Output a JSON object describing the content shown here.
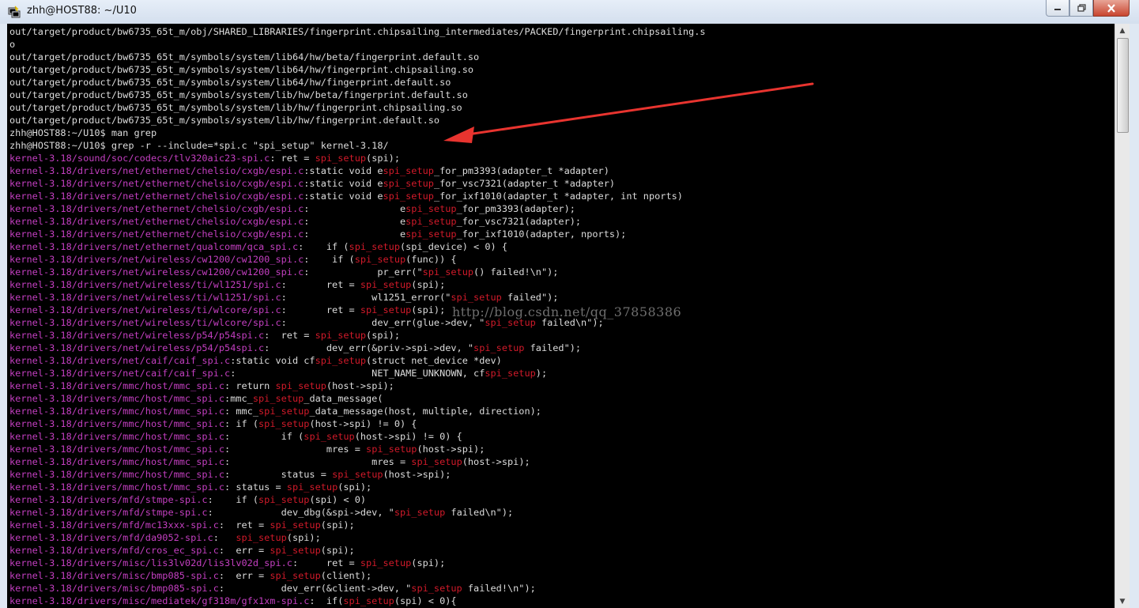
{
  "window": {
    "title": "zhh@HOST88: ~/U10",
    "minimize_icon": "minimize-icon",
    "maximize_icon": "maximize-icon",
    "close_icon": "close-icon"
  },
  "watermark": "http://blog.csdn.net/qq_37858386",
  "colors": {
    "terminal_bg": "#000000",
    "text": "#dcdcdc",
    "filename": "#c43fc1",
    "match": "#d21a2a",
    "annotation_arrow": "#e8342f"
  },
  "terminal": {
    "lines": [
      [
        {
          "t": "out/target/product/bw6735_65t_m/obj/SHARED_LIBRARIES/fingerprint.chipsailing_intermediates/PACKED/fingerprint.chipsailing.s"
        }
      ],
      [
        {
          "t": "o"
        }
      ],
      [
        {
          "t": "out/target/product/bw6735_65t_m/symbols/system/lib64/hw/beta/fingerprint.default.so"
        }
      ],
      [
        {
          "t": "out/target/product/bw6735_65t_m/symbols/system/lib64/hw/fingerprint.chipsailing.so"
        }
      ],
      [
        {
          "t": "out/target/product/bw6735_65t_m/symbols/system/lib64/hw/fingerprint.default.so"
        }
      ],
      [
        {
          "t": "out/target/product/bw6735_65t_m/symbols/system/lib/hw/beta/fingerprint.default.so"
        }
      ],
      [
        {
          "t": "out/target/product/bw6735_65t_m/symbols/system/lib/hw/fingerprint.chipsailing.so"
        }
      ],
      [
        {
          "t": "out/target/product/bw6735_65t_m/symbols/system/lib/hw/fingerprint.default.so"
        }
      ],
      [
        {
          "t": "zhh@HOST88:~/U10$ man grep"
        }
      ],
      [
        {
          "t": "zhh@HOST88:~/U10$ grep -r --include=*spi.c \"spi_setup\" kernel-3.18/"
        }
      ],
      [
        {
          "t": "kernel-3.18/sound/soc/codecs/tlv320aic23-spi.c",
          "c": "fn"
        },
        {
          "t": ": ret = "
        },
        {
          "t": "spi_setup",
          "c": "mt"
        },
        {
          "t": "(spi);"
        }
      ],
      [
        {
          "t": "kernel-3.18/drivers/net/ethernet/chelsio/cxgb/espi.c",
          "c": "fn"
        },
        {
          "t": ":static void e"
        },
        {
          "t": "spi_setup",
          "c": "mt"
        },
        {
          "t": "_for_pm3393(adapter_t *adapter)"
        }
      ],
      [
        {
          "t": "kernel-3.18/drivers/net/ethernet/chelsio/cxgb/espi.c",
          "c": "fn"
        },
        {
          "t": ":static void e"
        },
        {
          "t": "spi_setup",
          "c": "mt"
        },
        {
          "t": "_for_vsc7321(adapter_t *adapter)"
        }
      ],
      [
        {
          "t": "kernel-3.18/drivers/net/ethernet/chelsio/cxgb/espi.c",
          "c": "fn"
        },
        {
          "t": ":static void e"
        },
        {
          "t": "spi_setup",
          "c": "mt"
        },
        {
          "t": "_for_ixf1010(adapter_t *adapter, int nports)"
        }
      ],
      [
        {
          "t": "kernel-3.18/drivers/net/ethernet/chelsio/cxgb/espi.c",
          "c": "fn"
        },
        {
          "t": ":                e"
        },
        {
          "t": "spi_setup",
          "c": "mt"
        },
        {
          "t": "_for_pm3393(adapter);"
        }
      ],
      [
        {
          "t": "kernel-3.18/drivers/net/ethernet/chelsio/cxgb/espi.c",
          "c": "fn"
        },
        {
          "t": ":                e"
        },
        {
          "t": "spi_setup",
          "c": "mt"
        },
        {
          "t": "_for_vsc7321(adapter);"
        }
      ],
      [
        {
          "t": "kernel-3.18/drivers/net/ethernet/chelsio/cxgb/espi.c",
          "c": "fn"
        },
        {
          "t": ":                e"
        },
        {
          "t": "spi_setup",
          "c": "mt"
        },
        {
          "t": "_for_ixf1010(adapter, nports);"
        }
      ],
      [
        {
          "t": "kernel-3.18/drivers/net/ethernet/qualcomm/qca_spi.c",
          "c": "fn"
        },
        {
          "t": ":    if ("
        },
        {
          "t": "spi_setup",
          "c": "mt"
        },
        {
          "t": "(spi_device) < 0) {"
        }
      ],
      [
        {
          "t": "kernel-3.18/drivers/net/wireless/cw1200/cw1200_spi.c",
          "c": "fn"
        },
        {
          "t": ":    if ("
        },
        {
          "t": "spi_setup",
          "c": "mt"
        },
        {
          "t": "(func)) {"
        }
      ],
      [
        {
          "t": "kernel-3.18/drivers/net/wireless/cw1200/cw1200_spi.c",
          "c": "fn"
        },
        {
          "t": ":            pr_err(\""
        },
        {
          "t": "spi_setup",
          "c": "mt"
        },
        {
          "t": "() failed!\\n\");"
        }
      ],
      [
        {
          "t": "kernel-3.18/drivers/net/wireless/ti/wl1251/spi.c",
          "c": "fn"
        },
        {
          "t": ":       ret = "
        },
        {
          "t": "spi_setup",
          "c": "mt"
        },
        {
          "t": "(spi);"
        }
      ],
      [
        {
          "t": "kernel-3.18/drivers/net/wireless/ti/wl1251/spi.c",
          "c": "fn"
        },
        {
          "t": ":               wl1251_error(\""
        },
        {
          "t": "spi_setup",
          "c": "mt"
        },
        {
          "t": " failed\");"
        }
      ],
      [
        {
          "t": "kernel-3.18/drivers/net/wireless/ti/wlcore/spi.c",
          "c": "fn"
        },
        {
          "t": ":       ret = "
        },
        {
          "t": "spi_setup",
          "c": "mt"
        },
        {
          "t": "(spi);"
        }
      ],
      [
        {
          "t": "kernel-3.18/drivers/net/wireless/ti/wlcore/spi.c",
          "c": "fn"
        },
        {
          "t": ":               dev_err(glue->dev, \""
        },
        {
          "t": "spi_setup",
          "c": "mt"
        },
        {
          "t": " failed\\n\");"
        }
      ],
      [
        {
          "t": "kernel-3.18/drivers/net/wireless/p54/p54spi.c",
          "c": "fn"
        },
        {
          "t": ":  ret = "
        },
        {
          "t": "spi_setup",
          "c": "mt"
        },
        {
          "t": "(spi);"
        }
      ],
      [
        {
          "t": "kernel-3.18/drivers/net/wireless/p54/p54spi.c",
          "c": "fn"
        },
        {
          "t": ":          dev_err(&priv->spi->dev, \""
        },
        {
          "t": "spi_setup",
          "c": "mt"
        },
        {
          "t": " failed\");"
        }
      ],
      [
        {
          "t": "kernel-3.18/drivers/net/caif/caif_spi.c",
          "c": "fn"
        },
        {
          "t": ":static void cf"
        },
        {
          "t": "spi_setup",
          "c": "mt"
        },
        {
          "t": "(struct net_device *dev)"
        }
      ],
      [
        {
          "t": "kernel-3.18/drivers/net/caif/caif_spi.c",
          "c": "fn"
        },
        {
          "t": ":                        NET_NAME_UNKNOWN, cf"
        },
        {
          "t": "spi_setup",
          "c": "mt"
        },
        {
          "t": ");"
        }
      ],
      [
        {
          "t": "kernel-3.18/drivers/mmc/host/mmc_spi.c",
          "c": "fn"
        },
        {
          "t": ": return "
        },
        {
          "t": "spi_setup",
          "c": "mt"
        },
        {
          "t": "(host->spi);"
        }
      ],
      [
        {
          "t": "kernel-3.18/drivers/mmc/host/mmc_spi.c",
          "c": "fn"
        },
        {
          "t": ":mmc_"
        },
        {
          "t": "spi_setup",
          "c": "mt"
        },
        {
          "t": "_data_message("
        }
      ],
      [
        {
          "t": "kernel-3.18/drivers/mmc/host/mmc_spi.c",
          "c": "fn"
        },
        {
          "t": ": mmc_"
        },
        {
          "t": "spi_setup",
          "c": "mt"
        },
        {
          "t": "_data_message(host, multiple, direction);"
        }
      ],
      [
        {
          "t": "kernel-3.18/drivers/mmc/host/mmc_spi.c",
          "c": "fn"
        },
        {
          "t": ": if ("
        },
        {
          "t": "spi_setup",
          "c": "mt"
        },
        {
          "t": "(host->spi) != 0) {"
        }
      ],
      [
        {
          "t": "kernel-3.18/drivers/mmc/host/mmc_spi.c",
          "c": "fn"
        },
        {
          "t": ":         if ("
        },
        {
          "t": "spi_setup",
          "c": "mt"
        },
        {
          "t": "(host->spi) != 0) {"
        }
      ],
      [
        {
          "t": "kernel-3.18/drivers/mmc/host/mmc_spi.c",
          "c": "fn"
        },
        {
          "t": ":                 mres = "
        },
        {
          "t": "spi_setup",
          "c": "mt"
        },
        {
          "t": "(host->spi);"
        }
      ],
      [
        {
          "t": "kernel-3.18/drivers/mmc/host/mmc_spi.c",
          "c": "fn"
        },
        {
          "t": ":                         mres = "
        },
        {
          "t": "spi_setup",
          "c": "mt"
        },
        {
          "t": "(host->spi);"
        }
      ],
      [
        {
          "t": "kernel-3.18/drivers/mmc/host/mmc_spi.c",
          "c": "fn"
        },
        {
          "t": ":         status = "
        },
        {
          "t": "spi_setup",
          "c": "mt"
        },
        {
          "t": "(host->spi);"
        }
      ],
      [
        {
          "t": "kernel-3.18/drivers/mmc/host/mmc_spi.c",
          "c": "fn"
        },
        {
          "t": ": status = "
        },
        {
          "t": "spi_setup",
          "c": "mt"
        },
        {
          "t": "(spi);"
        }
      ],
      [
        {
          "t": "kernel-3.18/drivers/mfd/stmpe-spi.c",
          "c": "fn"
        },
        {
          "t": ":    if ("
        },
        {
          "t": "spi_setup",
          "c": "mt"
        },
        {
          "t": "(spi) < 0)"
        }
      ],
      [
        {
          "t": "kernel-3.18/drivers/mfd/stmpe-spi.c",
          "c": "fn"
        },
        {
          "t": ":            dev_dbg(&spi->dev, \""
        },
        {
          "t": "spi_setup",
          "c": "mt"
        },
        {
          "t": " failed\\n\");"
        }
      ],
      [
        {
          "t": "kernel-3.18/drivers/mfd/mc13xxx-spi.c",
          "c": "fn"
        },
        {
          "t": ":  ret = "
        },
        {
          "t": "spi_setup",
          "c": "mt"
        },
        {
          "t": "(spi);"
        }
      ],
      [
        {
          "t": "kernel-3.18/drivers/mfd/da9052-spi.c",
          "c": "fn"
        },
        {
          "t": ":   "
        },
        {
          "t": "spi_setup",
          "c": "mt"
        },
        {
          "t": "(spi);"
        }
      ],
      [
        {
          "t": "kernel-3.18/drivers/mfd/cros_ec_spi.c",
          "c": "fn"
        },
        {
          "t": ":  err = "
        },
        {
          "t": "spi_setup",
          "c": "mt"
        },
        {
          "t": "(spi);"
        }
      ],
      [
        {
          "t": "kernel-3.18/drivers/misc/lis3lv02d/lis3lv02d_spi.c",
          "c": "fn"
        },
        {
          "t": ":     ret = "
        },
        {
          "t": "spi_setup",
          "c": "mt"
        },
        {
          "t": "(spi);"
        }
      ],
      [
        {
          "t": "kernel-3.18/drivers/misc/bmp085-spi.c",
          "c": "fn"
        },
        {
          "t": ":  err = "
        },
        {
          "t": "spi_setup",
          "c": "mt"
        },
        {
          "t": "(client);"
        }
      ],
      [
        {
          "t": "kernel-3.18/drivers/misc/bmp085-spi.c",
          "c": "fn"
        },
        {
          "t": ":          dev_err(&client->dev, \""
        },
        {
          "t": "spi_setup",
          "c": "mt"
        },
        {
          "t": " failed!\\n\");"
        }
      ],
      [
        {
          "t": "kernel-3.18/drivers/misc/mediatek/gf318m/gfx1xm-spi.c",
          "c": "fn"
        },
        {
          "t": ":  if("
        },
        {
          "t": "spi_setup",
          "c": "mt"
        },
        {
          "t": "(spi) < 0){"
        }
      ]
    ]
  }
}
